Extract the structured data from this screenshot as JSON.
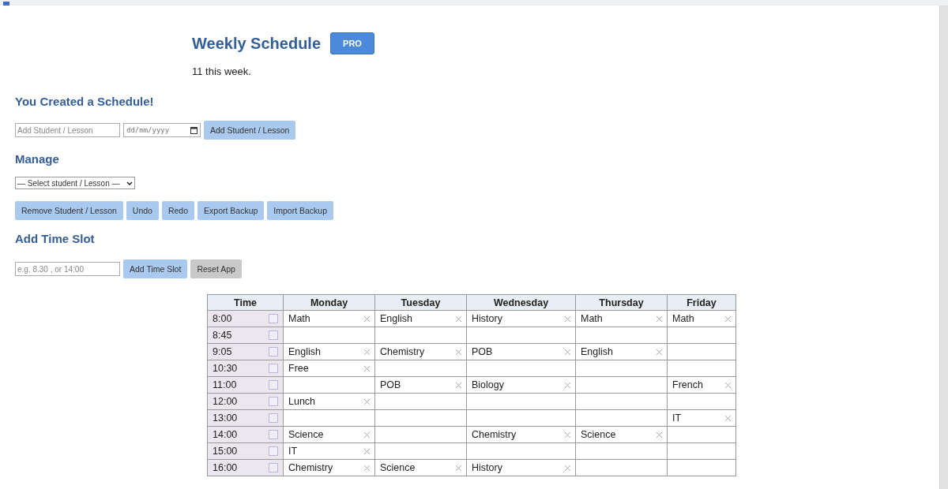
{
  "header": {
    "title": "Weekly Schedule",
    "badge": "PRO",
    "summary": "11 this week."
  },
  "create": {
    "heading": "You Created a Schedule!",
    "name_placeholder": "Add Student / Lesson",
    "date_placeholder": "dd/mm/yyyy",
    "button": "Add Student / Lesson"
  },
  "manage": {
    "heading": "Manage",
    "select": "— Select student / Lesson —",
    "buttons": [
      "Remove Student / Lesson",
      "Undo",
      "Redo",
      "Export Backup",
      "Import Backup"
    ]
  },
  "time_slot": {
    "heading": "Add Time Slot",
    "placeholder": "e.g. 8.30 , or 14:00",
    "buttons": [
      {
        "label": "Add Time Slot",
        "kind": "primary"
      },
      {
        "label": "Reset App",
        "kind": "neutral"
      }
    ]
  },
  "table": {
    "columns": [
      "Time",
      "Monday",
      "Tuesday",
      "Wednesday",
      "Thursday",
      "Friday"
    ],
    "rows": [
      [
        "8:00",
        "Math",
        "English",
        "History",
        "Math",
        "Math"
      ],
      [
        "8:45",
        "",
        "",
        "",
        "",
        ""
      ],
      [
        "9:05",
        "English",
        "Chemistry",
        "POB",
        "English",
        ""
      ],
      [
        "10:30",
        "Free",
        "",
        "",
        "",
        ""
      ],
      [
        "11:00",
        "",
        "POB",
        "Biology",
        "",
        "French"
      ],
      [
        "12:00",
        "Lunch",
        "",
        "",
        "",
        ""
      ],
      [
        "13:00",
        "",
        "",
        "",
        "",
        "IT"
      ],
      [
        "14:00",
        "Science",
        "",
        "Chemistry",
        "Science",
        ""
      ],
      [
        "15:00",
        "IT",
        "",
        "",
        "",
        ""
      ],
      [
        "16:00",
        "Chemistry",
        "Science",
        "History",
        "",
        ""
      ]
    ]
  }
}
